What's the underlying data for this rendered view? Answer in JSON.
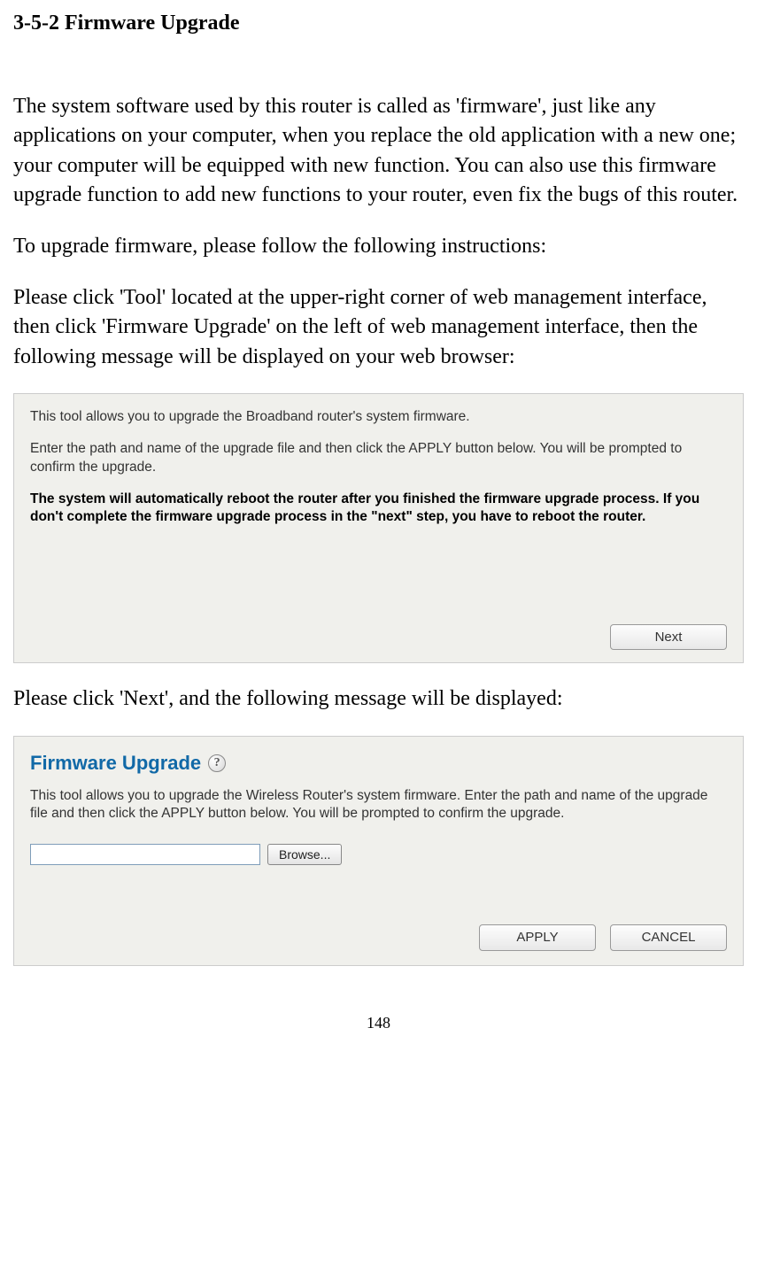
{
  "section_title": "3-5-2 Firmware Upgrade",
  "para1": "The system software used by this router is called as 'firmware', just like any applications on your computer, when you replace the old application with a new one; your computer will be equipped with new function. You can also use this firmware upgrade function to add new functions to your router, even fix the bugs of this router.",
  "para2": "To upgrade firmware, please follow the following instructions:",
  "para3": "Please click 'Tool' located at the upper-right corner of web management interface, then click 'Firmware Upgrade' on the left of web management interface, then the following message will be displayed on your web browser:",
  "screenshot1": {
    "line1": "This tool allows you to upgrade the Broadband router's system firmware.",
    "line2": "Enter the path and name of the upgrade file and then click the APPLY button below. You will be prompted to confirm the upgrade.",
    "bold": "The system will automatically reboot the router after you finished the firmware upgrade process. If you don't complete the firmware upgrade process in the \"next\" step, you have to reboot the router.",
    "next_btn": "Next"
  },
  "para4": "Please click 'Next', and the following message will be displayed:",
  "screenshot2": {
    "title": "Firmware Upgrade",
    "help_icon": "?",
    "text": "This tool allows you to upgrade the Wireless Router's system firmware. Enter the path and name of the upgrade file and then click the APPLY button below. You will be prompted to confirm the upgrade.",
    "file_value": "",
    "browse_btn": "Browse...",
    "apply_btn": "APPLY",
    "cancel_btn": "CANCEL"
  },
  "page_number": "148"
}
